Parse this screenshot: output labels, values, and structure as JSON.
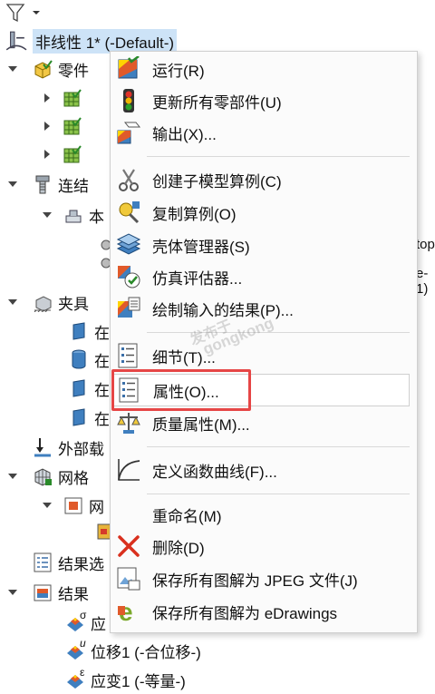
{
  "toolbar": {
    "filter_icon": "filter-icon"
  },
  "tree": {
    "root": "非线性 1* (-Default-)",
    "parts": "零件",
    "connections": "连结",
    "connection_child": "本",
    "fixtures": "夹具",
    "fixture_items": [
      "在",
      "在",
      "在",
      "在"
    ],
    "external_loads": "外部载",
    "mesh": "网格",
    "mesh_child": "网",
    "result_options": "结果选",
    "results": "结果",
    "result_items": [
      {
        "label": "应",
        "sup": "σ"
      },
      {
        "label": "位移1 (-合位移-)",
        "sup": "u"
      },
      {
        "label": "应变1 (-等量-)",
        "sup": "ε"
      }
    ],
    "behind_text": [
      "top",
      "e-1)"
    ]
  },
  "menu": {
    "items": [
      {
        "label": "运行(R)",
        "icon": "run-icon"
      },
      {
        "label": "更新所有零部件(U)",
        "icon": "traffic-light-icon"
      },
      {
        "label": "输出(X)...",
        "icon": "export-icon"
      },
      {
        "label": "创建子模型算例(C)",
        "icon": "scissors-icon"
      },
      {
        "label": "复制算例(O)",
        "icon": "copy-study-icon"
      },
      {
        "label": "壳体管理器(S)",
        "icon": "shell-manager-icon"
      },
      {
        "label": "仿真评估器...",
        "icon": "simulation-evaluator-icon"
      },
      {
        "label": "绘制输入的结果(P)...",
        "icon": "plot-results-icon"
      },
      {
        "label": "细节(T)...",
        "icon": "details-icon"
      },
      {
        "label": "属性(O)...",
        "icon": "properties-icon"
      },
      {
        "label": "质量属性(M)...",
        "icon": "mass-properties-icon"
      },
      {
        "label": "定义函数曲线(F)...",
        "icon": "function-curve-icon"
      },
      {
        "label": "重命名(M)",
        "icon": ""
      },
      {
        "label": "删除(D)",
        "icon": "delete-icon"
      },
      {
        "label": "保存所有图解为 JPEG 文件(J)",
        "icon": "save-jpeg-icon"
      },
      {
        "label": "保存所有图解为 eDrawings",
        "icon": "edrawings-icon"
      }
    ]
  },
  "watermark": {
    "line1": "发布于",
    "line2": "gongkong",
    "mark": "®"
  },
  "colors": {
    "highlight_border": "#e64646",
    "selection": "#cde3f7"
  }
}
